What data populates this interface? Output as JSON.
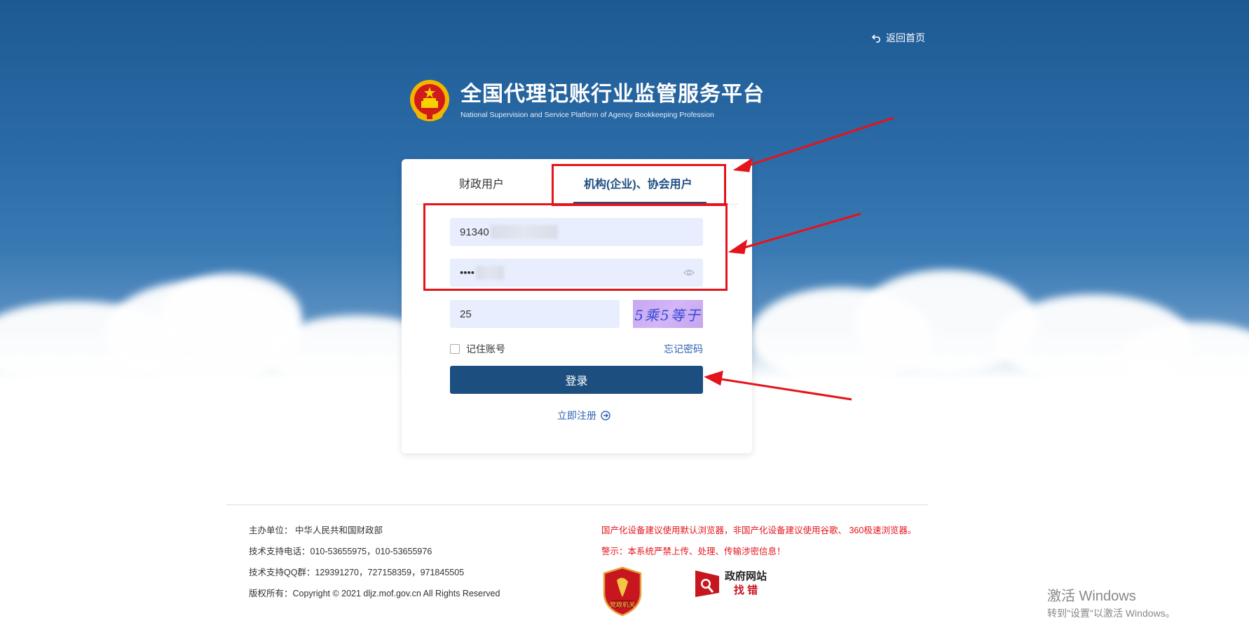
{
  "header": {
    "back_home_label": "返回首页",
    "title": "全国代理记账行业监管服务平台",
    "subtitle": "National Supervision and Service Platform of Agency Bookkeeping  Profession"
  },
  "login": {
    "tabs": [
      {
        "label": "财政用户",
        "active": false
      },
      {
        "label": "机构(企业)、协会用户",
        "active": true
      }
    ],
    "username_value": "91340",
    "password_value": "••••",
    "captcha_value": "25",
    "captcha_text": "5乘5等于",
    "remember_label": "记住账号",
    "forgot_label": "忘记密码",
    "submit_label": "登录",
    "register_label": "立即注册"
  },
  "footer": {
    "host": "主办单位： 中华人民共和国财政部",
    "phone": "技术支持电话：010-53655975，010-53655976",
    "qq": "技术支持QQ群：129391270，727158359，971845505",
    "copyright": "版权所有：Copyright © 2021 dljz.mof.gov.cn All Rights Reserved",
    "notice": "国产化设备建议使用默认浏览器，非国产化设备建议使用谷歌、 360极速浏览器。",
    "warning": "警示：本系统严禁上传、处理、传输涉密信息！",
    "badge_party": "党政机关",
    "badge_gov_line1": "政府网站",
    "badge_gov_line2": "找 错"
  },
  "watermark": {
    "line1": "激活 Windows",
    "line2": "转到\"设置\"以激活 Windows。"
  },
  "colors": {
    "primary": "#1c4f80",
    "link": "#2f62b5",
    "annotation_red": "#e5131b",
    "input_bg": "#e8eefe"
  }
}
